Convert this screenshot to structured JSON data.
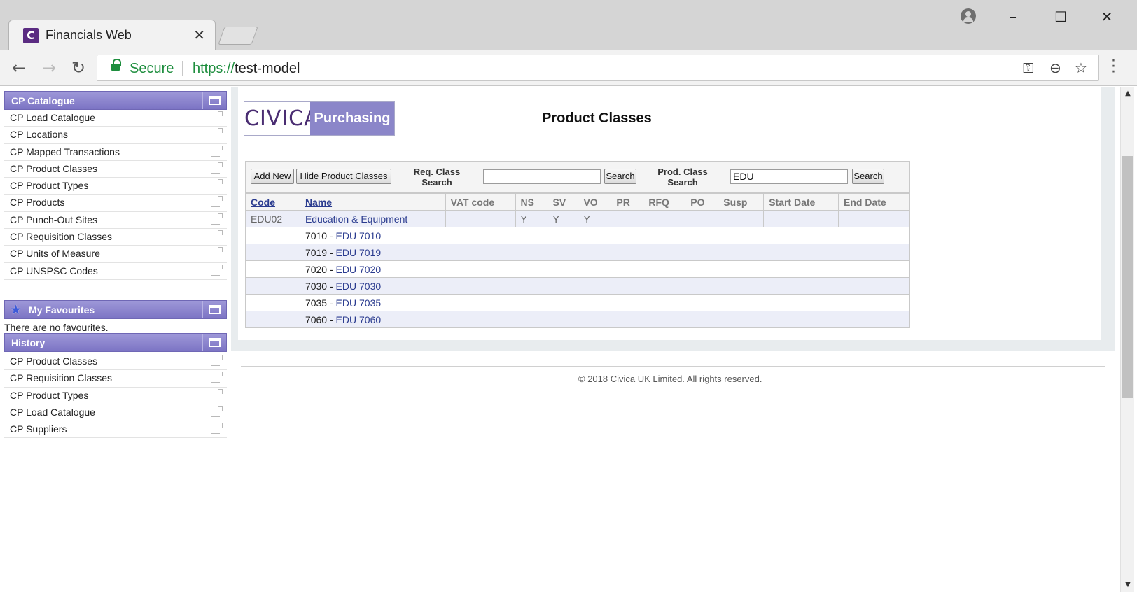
{
  "browser": {
    "tab_title": "Financials Web",
    "tab_favicon": "C",
    "secure_label": "Secure",
    "url_scheme": "https://",
    "url_host": "test-model",
    "close_glyph": "✕",
    "icons": [
      "back-arrow-icon",
      "forward-arrow-icon",
      "reload-icon",
      "lock-icon",
      "key-icon",
      "zoom-out-icon",
      "star-icon",
      "menu-icon",
      "profile-icon"
    ]
  },
  "sidebar": {
    "catalogue": {
      "title": "CP Catalogue",
      "items": [
        {
          "label": "CP Load Catalogue"
        },
        {
          "label": "CP Locations"
        },
        {
          "label": "CP Mapped Transactions"
        },
        {
          "label": "CP Product Classes"
        },
        {
          "label": "CP Product Types"
        },
        {
          "label": "CP Products"
        },
        {
          "label": "CP Punch-Out Sites"
        },
        {
          "label": "CP Requisition Classes"
        },
        {
          "label": "CP Units of Measure"
        },
        {
          "label": "CP UNSPSC Codes"
        }
      ]
    },
    "favourites": {
      "title": "My Favourites",
      "empty_text": "There are no favourites."
    },
    "history": {
      "title": "History",
      "items": [
        {
          "label": "CP Product Classes"
        },
        {
          "label": "CP Requisition Classes"
        },
        {
          "label": "CP Product Types"
        },
        {
          "label": "CP Load Catalogue"
        },
        {
          "label": "CP Suppliers"
        }
      ]
    }
  },
  "main": {
    "logo_left": "CIVICA",
    "logo_right": "Purchasing",
    "title": "Product Classes",
    "toolbar": {
      "add_new": "Add New",
      "hide_classes": "Hide Product Classes",
      "req_label_1": "Req. Class",
      "req_label_2": "Search",
      "req_value": "",
      "req_search": "Search",
      "prod_label_1": "Prod. Class",
      "prod_label_2": "Search",
      "prod_value": "EDU",
      "prod_search": "Search"
    },
    "columns": [
      "Code",
      "Name",
      "VAT code",
      "NS",
      "SV",
      "VO",
      "PR",
      "RFQ",
      "PO",
      "Susp",
      "Start Date",
      "End Date"
    ],
    "parent_row": {
      "code": "EDU02",
      "name": "Education & Equipment",
      "vat": "",
      "ns": "Y",
      "sv": "Y",
      "vo": "Y",
      "pr": "",
      "rfq": "",
      "po": "",
      "susp": "",
      "start": "",
      "end": ""
    },
    "child_rows": [
      {
        "code": "7010",
        "sep": " - ",
        "name": "EDU 7010"
      },
      {
        "code": "7019",
        "sep": " - ",
        "name": "EDU 7019"
      },
      {
        "code": "7020",
        "sep": " - ",
        "name": "EDU 7020"
      },
      {
        "code": "7030",
        "sep": " - ",
        "name": "EDU 7030"
      },
      {
        "code": "7035",
        "sep": " - ",
        "name": "EDU 7035"
      },
      {
        "code": "7060",
        "sep": " - ",
        "name": "EDU 7060"
      }
    ],
    "footer": "© 2018 Civica UK Limited. All rights reserved."
  },
  "colors": {
    "accent": "#8b86c9",
    "header_purple": "#7c74c4",
    "link_blue": "#2a3b8f",
    "secure_green": "#1e8e3e"
  }
}
